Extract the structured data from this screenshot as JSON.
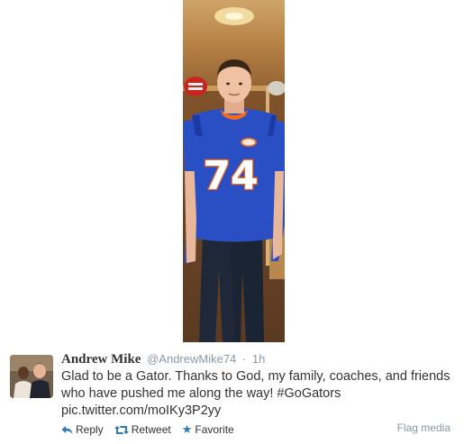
{
  "tweet": {
    "fullname": "Andrew Mike",
    "screen_name": "@AndrewMike74",
    "separator": "·",
    "timestamp": "1h",
    "text_lines": [
      "Glad to be a Gator. Thanks to God, my family, coaches, and friends",
      "who have pushed me along the way! #GoGators",
      "pic.twitter.com/moIKy3P2yy"
    ]
  },
  "photo": {
    "jersey_number": "74",
    "jersey_color": "#2a4fc4",
    "pants_color": "#1f2838"
  },
  "actions": {
    "reply": {
      "label": "Reply",
      "icon": "reply-icon"
    },
    "retweet": {
      "label": "Retweet",
      "icon": "retweet-icon"
    },
    "favorite": {
      "label": "Favorite",
      "icon": "star-icon"
    },
    "flag_media": "Flag media"
  },
  "colors": {
    "link_blue": "#2b7bb9",
    "muted_gray": "#8899a6",
    "text": "#333333"
  }
}
